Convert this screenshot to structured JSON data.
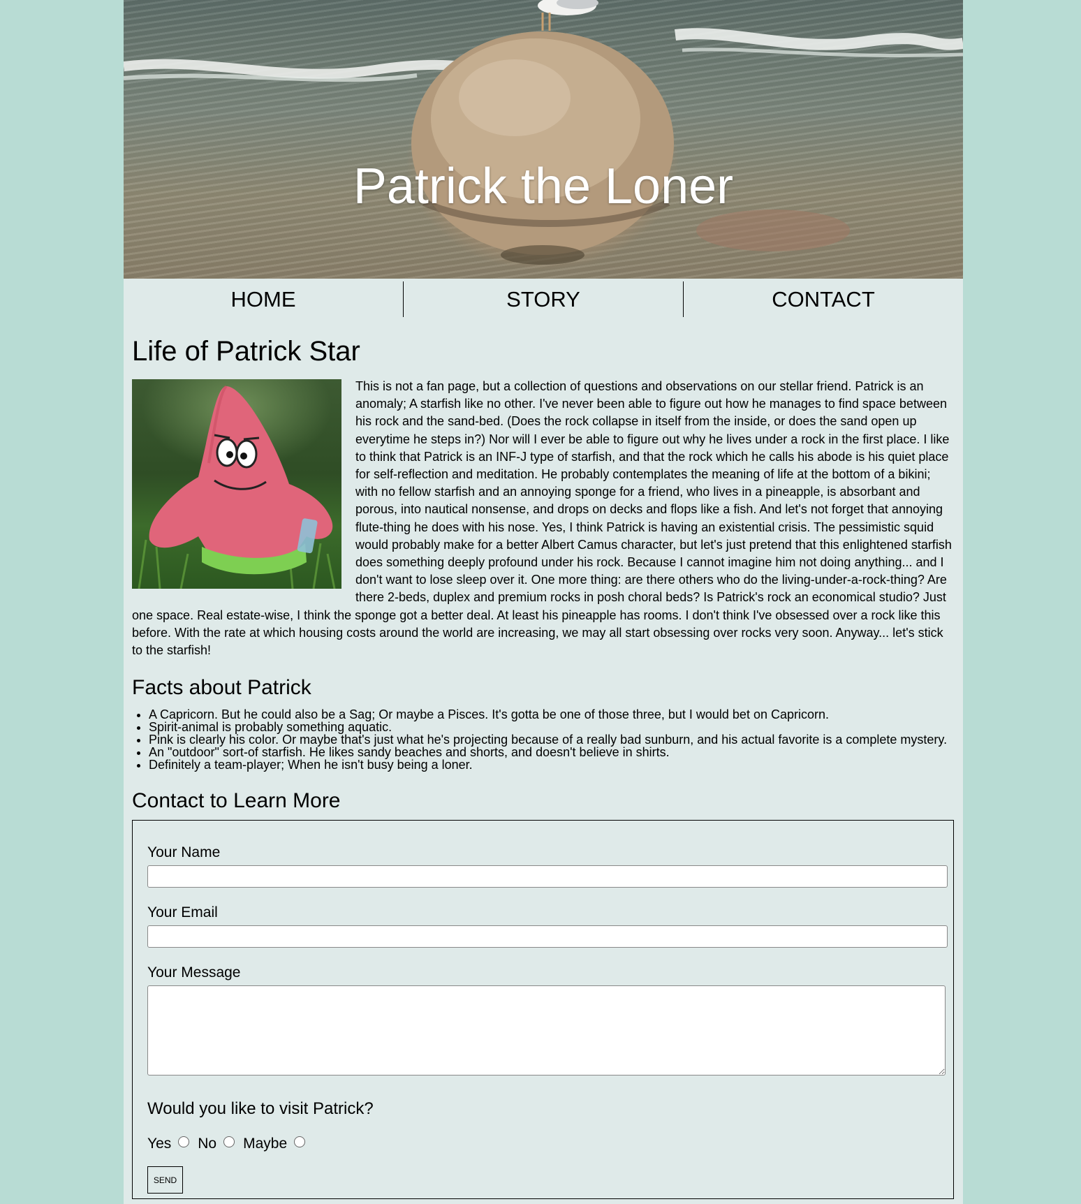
{
  "hero": {
    "title": "Patrick the Loner"
  },
  "nav": {
    "items": [
      {
        "label": "HOME"
      },
      {
        "label": "STORY"
      },
      {
        "label": "CONTACT"
      }
    ]
  },
  "story": {
    "title": "Life of Patrick Star",
    "text": "This is not a fan page, but a collection of questions and observations on our stellar friend. Patrick is an anomaly; A starfish like no other. I've never been able to figure out how he manages to find space between his rock and the sand-bed. (Does the rock collapse in itself from the inside, or does the sand open up everytime he steps in?) Nor will I ever be able to figure out why he lives under a rock in the first place. I like to think that Patrick is an INF-J type of starfish, and that the rock which he calls his abode is his quiet place for self-reflection and meditation. He probably contemplates the meaning of life at the bottom of a bikini; with no fellow starfish and an annoying sponge for a friend, who lives in a pineapple, is absorbant and porous, into nautical nonsense, and drops on decks and flops like a fish. And let's not forget that annoying flute-thing he does with his nose. Yes, I think Patrick is having an existential crisis. The pessimistic squid would probably make for a better Albert Camus character, but let's just pretend that this enlightened starfish does something deeply profound under his rock. Because I cannot imagine him not doing anything... and I don't want to lose sleep over it. One more thing: are there others who do the living-under-a-rock-thing? Are there 2-beds, duplex and premium rocks in posh choral beds? Is Patrick's rock an economical studio? Just one space. Real estate-wise, I think the sponge got a better deal. At least his pineapple has rooms. I don't think I've obsessed over a rock like this before. With the rate at which housing costs around the world are increasing, we may all start obsessing over rocks very soon. Anyway... let's stick to the starfish!"
  },
  "facts": {
    "title": "Facts about Patrick",
    "items": [
      "A Capricorn. But he could also be a Sag; Or maybe a Pisces. It's gotta be one of those three, but I would bet on Capricorn.",
      "Spirit-animal is probably something aquatic.",
      "Pink is clearly his color. Or maybe that's just what he's projecting because of a really bad sunburn, and his actual favorite is a complete mystery.",
      "An \"outdoor\" sort-of starfish. He likes sandy beaches and shorts, and doesn't believe in shirts.",
      "Definitely a team-player; When he isn't busy being a loner."
    ]
  },
  "contact": {
    "title": "Contact to Learn More",
    "name_label": "Your Name",
    "name_value": "",
    "email_label": "Your Email",
    "email_value": "",
    "message_label": "Your Message",
    "message_value": "",
    "visit_question": "Would you like to visit Patrick?",
    "options": [
      "Yes",
      "No",
      "Maybe"
    ],
    "send_label": "SEND"
  },
  "colors": {
    "background": "#b8dcd4",
    "page": "#dfeae9",
    "starfish_pink": "#e0657a",
    "hero_title": "#ffffff"
  }
}
